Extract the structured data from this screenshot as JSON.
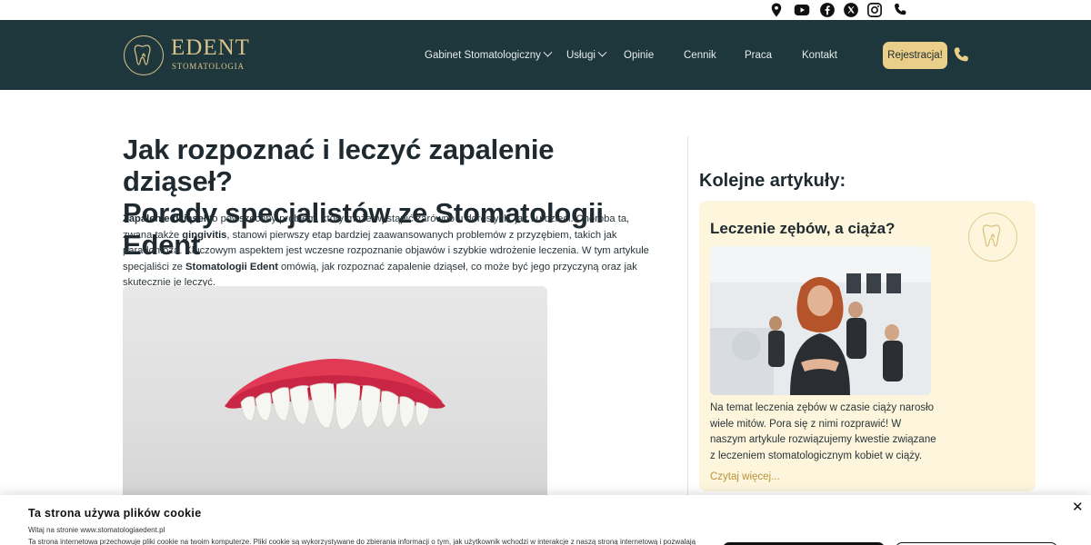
{
  "brand": {
    "name": "EDENT",
    "subtitle": "STOMATOLOGIA",
    "gold": "#d9c38a",
    "header_bg": "#1e373d",
    "cta_bg": "#e9cf8a"
  },
  "social_icons": [
    "location-pin-icon",
    "youtube-icon",
    "facebook-icon",
    "x-icon",
    "instagram-icon",
    "phone-icon"
  ],
  "nav": {
    "items": [
      {
        "label": "Gabinet Stomatologiczny",
        "dropdown": true
      },
      {
        "label": "Usługi",
        "dropdown": true
      },
      {
        "label": "Opinie",
        "dropdown": false
      },
      {
        "label": "Cennik",
        "dropdown": false
      },
      {
        "label": "Praca",
        "dropdown": false
      },
      {
        "label": "Kontakt",
        "dropdown": false
      }
    ],
    "cta_label": "Rejestracja!"
  },
  "article": {
    "title_line1": "Jak rozpoznać i leczyć zapalenie dziąseł?",
    "title_line2": "Porady specjalistów ze Stomatologii Edent",
    "intro": {
      "b1": "Zapalenie dziąseł",
      "t1": " to powszechny problem, który może wystąpić zarówno u dorosłych, jak i u dzieci. Choroba ta, zwana także ",
      "b2": "gingivitis",
      "t2": ", stanowi pierwszy etap bardziej zaawansowanych problemów z przyzębiem, takich jak paradontoza. Kluczowym aspektem jest wczesne rozpoznanie objawów i szybkie wdrożenie leczenia. W tym artykule specjaliści ze ",
      "b3": "Stomatologii Edent",
      "t3": " omówią, jak rozpoznać zapalenie dziąseł, co może być jego przyczyną oraz jak skutecznie je leczyć."
    }
  },
  "sidebar": {
    "heading": "Kolejne artykuły:",
    "card": {
      "title": "Leczenie zębów, a ciąża?",
      "text": "Na temat leczenia zębów w czasie ciąży narosło wiele mitów. Pora się z nimi rozprawić! W naszym artykule rozwiązujemy kwestie związane z leczeniem stomatologicznym kobiet w ciąży.",
      "read_more": "Czytaj więcej..."
    }
  },
  "cookie": {
    "title": "Ta strona używa plików cookie",
    "subtitle": "Witaj na stronie www.stomatologiaedent.pl",
    "body": "Ta strona internetowa przechowuje pliki cookie na twoim komputerze. Pliki cookie są wykorzystywane do zbierania informacji o tym, jak użytkownik wchodzi w interakcje z naszą stroną internetową i pozwalają",
    "close": "✕"
  }
}
